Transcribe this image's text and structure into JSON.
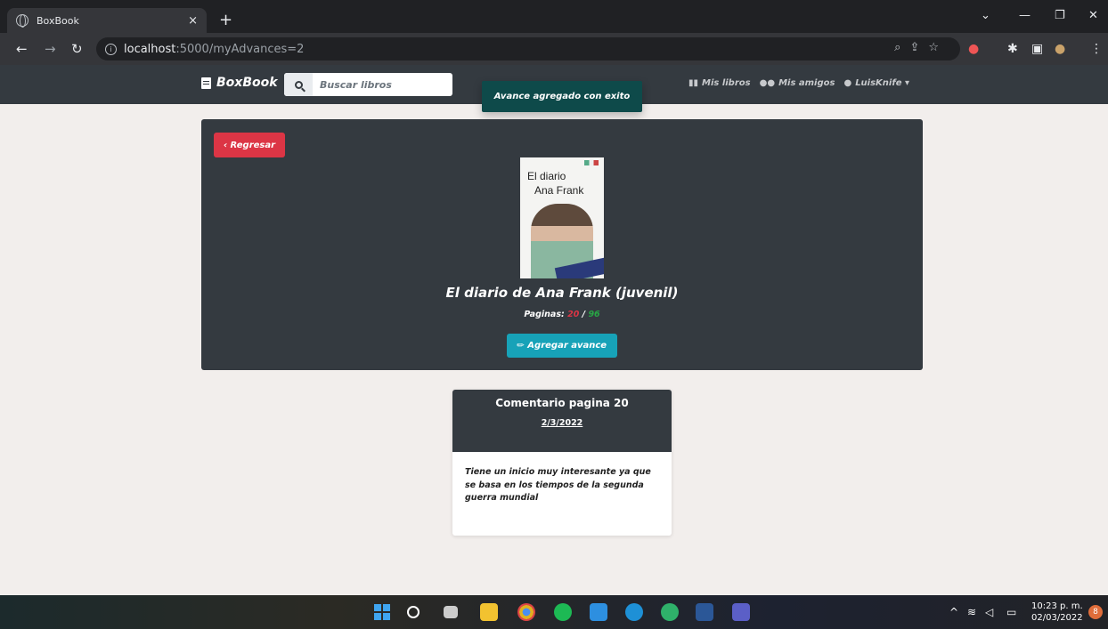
{
  "browser": {
    "tab_title": "BoxBook",
    "tab_close": "×",
    "new_tab": "+",
    "url_host": "localhost",
    "url_path": ":5000/myAdvances=2",
    "window_min": "—",
    "window_restore": "❐",
    "window_close": "✕",
    "tab_search": "⌄"
  },
  "navbar": {
    "brand": "BoxBook",
    "search_placeholder": "Buscar libros",
    "links": {
      "my_books": "Mis libros",
      "my_friends": "Mis amigos",
      "user": "LuisKnife"
    }
  },
  "toast": {
    "message": "Avance agregado con exito"
  },
  "book": {
    "back_label": "Regresar",
    "cover_line1": "El diario",
    "cover_line2": "Ana Frank",
    "title": "El diario de Ana Frank (juvenil)",
    "pages_label": "Paginas:",
    "pages_current": "20",
    "pages_sep": "/",
    "pages_total": "96",
    "add_label": "Agregar avance"
  },
  "comment": {
    "title": "Comentario pagina 20",
    "date": "2/3/2022",
    "text": "Tiene un inicio muy interesante ya que se basa en los tiempos de la segunda guerra mundial"
  },
  "taskbar": {
    "time": "10:23 p. m.",
    "date": "02/03/2022",
    "notifications": "8"
  },
  "colors": {
    "navbar": "#343a40",
    "danger": "#dc3545",
    "info": "#17a2b8",
    "success": "#28a745",
    "toast": "#0e4a4a",
    "page_bg": "#f2eeec"
  }
}
